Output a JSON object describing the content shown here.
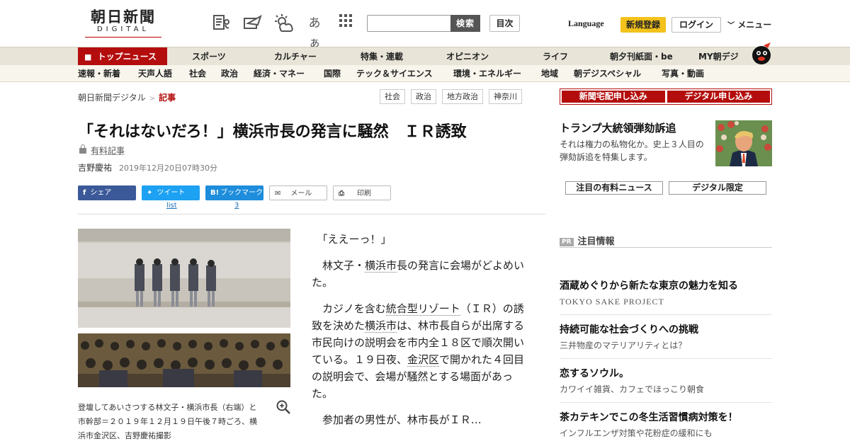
{
  "header": {
    "logo_main": "朝日新聞",
    "logo_sub": "DIGITAL",
    "icons": [
      "newspaper-sound-icon",
      "paper-plane-icon",
      "weather-icon",
      "font-size-icon",
      "grid-icon"
    ],
    "font_size_glyph": "あぁ",
    "search_placeholder": "",
    "search_label": "検索",
    "index_label": "目次",
    "language_label": "Language",
    "register_label": "新規登録",
    "login_label": "ログイン",
    "menu_label": "メニュー"
  },
  "nav_primary": [
    "トップニュース",
    "スポーツ",
    "カルチャー",
    "特集・連載",
    "オピニオン",
    "ライフ",
    "朝夕刊紙面・be",
    "MY朝デジ"
  ],
  "nav_secondary": [
    "速報・新着",
    "天声人語",
    "社会",
    "政治",
    "経済・マネー",
    "国際",
    "テック＆サイエンス",
    "環境・エネルギー",
    "地域",
    "朝デジスペシャル",
    "写真・動画"
  ],
  "breadcrumb": {
    "site": "朝日新聞デジタル",
    "current": "記事"
  },
  "tags": [
    "社会",
    "政治",
    "地方政治",
    "神奈川"
  ],
  "article": {
    "title": "「それはないだろ！」横浜市長の発言に騒然　ＩＲ誘致",
    "paid_label": "有料記事",
    "author": "吉野慶祐",
    "date": "2019年12月20日07時30分",
    "share": {
      "facebook": "シェア",
      "twitter": "ツイート",
      "hatena": "ブックマーク",
      "mail": "メール",
      "print": "印刷",
      "twitter_count": "list",
      "hatena_count": "3"
    },
    "caption": "登壇してあいさつする林文子・横浜市長（右端）と市幹部＝２０１９年１２月１９日午後７時ごろ、横浜市金沢区、吉野慶祐撮影",
    "paragraphs": {
      "p1": "「ええーっ！」",
      "p2a": "林文子・",
      "p2b": "横浜市",
      "p2c": "長の発言に会場がどよめいた。",
      "p3a": "カジノを含む",
      "p3b": "統合型リゾート",
      "p3c": "（ＩＲ）の誘致を決めた",
      "p3d": "横浜市",
      "p3e": "は、林市長自らが出席する市民向けの説明会を市内全１８区で順次開いている。１９日夜、",
      "p3f": "金沢区",
      "p3g": "で開かれた４回目の説明会で、会場が騒然とする場面があった。",
      "p4": "参加者の男性が、林市長がＩＲ…"
    }
  },
  "sidebar": {
    "subscribe_paper": "新聞宅配申し込み",
    "subscribe_digital": "デジタル申し込み",
    "feature_title": "トランプ大統領弾劾訴追",
    "feature_desc": "それは権力の私物化か。史上３人目の弾劾訴追を特集します。",
    "pill_paid": "注目の有料ニュース",
    "pill_digital": "デジタル限定",
    "pr_badge": "PR",
    "pr_heading": "注目情報",
    "pr_items": [
      {
        "title": "酒蔵めぐりから新たな東京の魅力を知る",
        "sub": "TOKYO SAKE PROJECT"
      },
      {
        "title": "持続可能な社会づくりへの挑戦",
        "sub": "三井物産のマテリアリティとは？"
      },
      {
        "title": "恋するソウル。",
        "sub": "カワイイ雑貨、カフェでほっこり朝食"
      },
      {
        "title": "茶カテキンでこの冬生活習慣病対策を！",
        "sub": "インフルエンザ対策や花粉症の緩和にも"
      }
    ]
  },
  "colors": {
    "brand_red": "#b40d0d",
    "nav_bg": "#e8e5d8",
    "register_yellow": "#f3c21b"
  }
}
